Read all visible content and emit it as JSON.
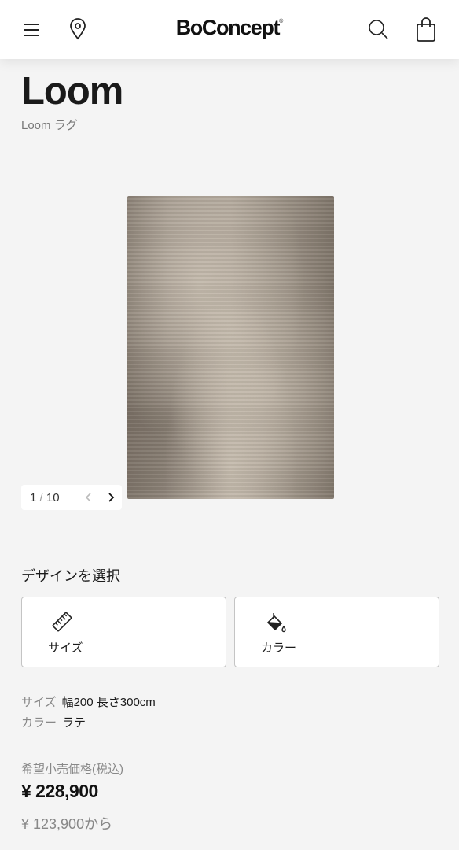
{
  "header": {
    "brand": "BoConcept",
    "brand_mark": "®",
    "icons": [
      "menu-icon",
      "location-pin-icon",
      "search-icon",
      "shopping-bag-icon"
    ]
  },
  "product": {
    "name": "Loom",
    "subtitle": "Loom ラグ",
    "rug_colors": {
      "base": "#9c9287",
      "light": "#d8cfc2",
      "dark": "#7f756a"
    }
  },
  "gallery": {
    "current": "1",
    "separator": "/",
    "total": "10"
  },
  "design": {
    "heading": "デザインを選択",
    "options": [
      {
        "label": "サイズ",
        "icon": "ruler-icon"
      },
      {
        "label": "カラー",
        "icon": "paint-bucket-icon"
      }
    ]
  },
  "specs": {
    "size_key": "サイズ",
    "size_value": "幅200 長さ300cm",
    "color_key": "カラー",
    "color_value": "ラテ"
  },
  "price": {
    "label": "希望小売価格(税込)",
    "amount": "¥ 228,900",
    "from": "¥ 123,900から"
  },
  "colors": {
    "background": "#f4f4f4",
    "card_border": "#c4c4c4",
    "muted_text": "#888888"
  }
}
